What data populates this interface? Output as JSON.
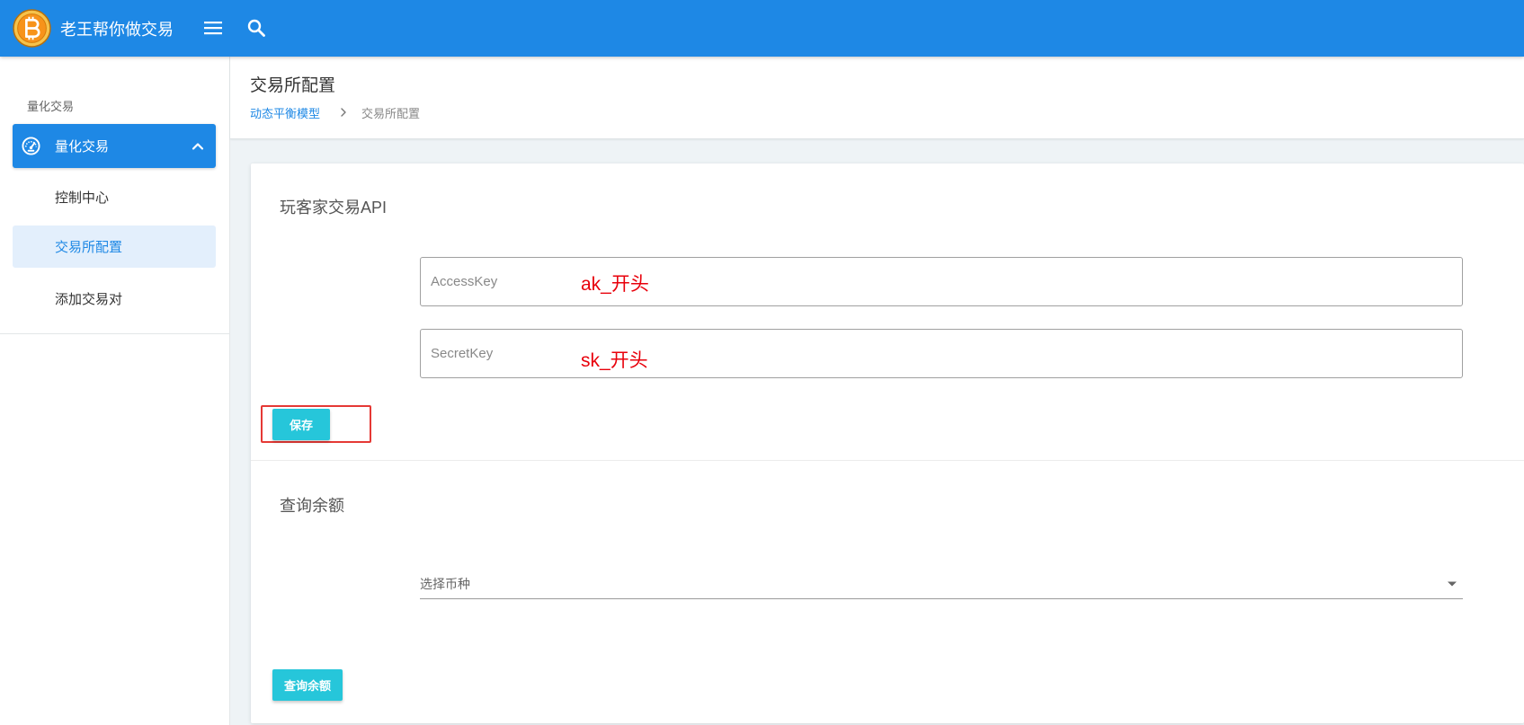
{
  "app": {
    "title": "老王帮你做交易",
    "logo": "bitcoin-logo"
  },
  "topbar": {
    "menu_icon": "hamburger-icon",
    "search_icon": "search-icon"
  },
  "sidebar": {
    "section_header": "量化交易",
    "group": {
      "label": "量化交易",
      "icon": "dashboard-icon",
      "expanded": true
    },
    "items": [
      {
        "label": "控制中心",
        "active": false
      },
      {
        "label": "交易所配置",
        "active": true
      },
      {
        "label": "添加交易对",
        "active": false
      }
    ]
  },
  "page": {
    "title": "交易所配置",
    "breadcrumb": {
      "parent": "动态平衡模型",
      "current": "交易所配置"
    }
  },
  "api_card": {
    "title": "玩客家交易API",
    "access_key": {
      "label": "AccessKey",
      "value": "",
      "annotation": "ak_开头"
    },
    "secret_key": {
      "label": "SecretKey",
      "value": "",
      "annotation": "sk_开头"
    },
    "save_label": "保存"
  },
  "balance_card": {
    "title": "查询余额",
    "select_placeholder": "选择币种",
    "query_label": "查询余额"
  },
  "colors": {
    "primary": "#1e88e5",
    "accent_button": "#26c6da",
    "annotation": "#e8000b",
    "active_item_bg": "#e3effc"
  }
}
